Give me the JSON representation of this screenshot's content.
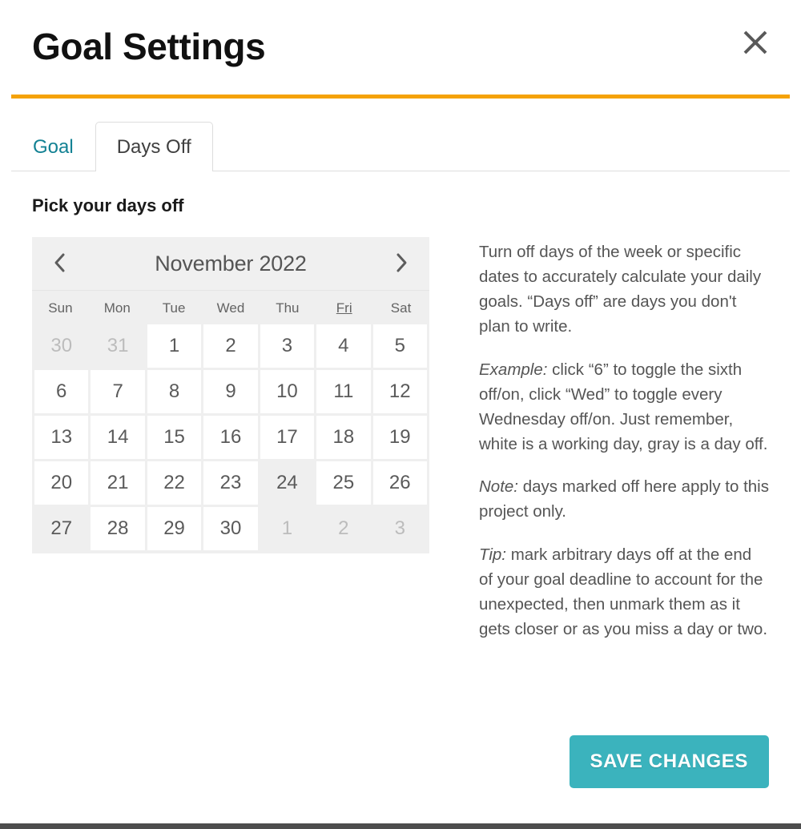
{
  "header": {
    "title": "Goal Settings",
    "close_icon": "close-icon",
    "rule_color": "#f5a207"
  },
  "tabs": [
    {
      "label": "Goal",
      "active": false
    },
    {
      "label": "Days Off",
      "active": true
    }
  ],
  "main": {
    "section_heading": "Pick your days off"
  },
  "calendar": {
    "prev_icon": "chevron-left-icon",
    "next_icon": "chevron-right-icon",
    "month_label": "November 2022",
    "weekdays": [
      {
        "label": "Sun",
        "underlined": false
      },
      {
        "label": "Mon",
        "underlined": false
      },
      {
        "label": "Tue",
        "underlined": false
      },
      {
        "label": "Wed",
        "underlined": false
      },
      {
        "label": "Thu",
        "underlined": false
      },
      {
        "label": "Fri",
        "underlined": true
      },
      {
        "label": "Sat",
        "underlined": false
      }
    ],
    "weeks": [
      [
        {
          "day": "30",
          "state": "outside"
        },
        {
          "day": "31",
          "state": "outside"
        },
        {
          "day": "1",
          "state": "work"
        },
        {
          "day": "2",
          "state": "work"
        },
        {
          "day": "3",
          "state": "work"
        },
        {
          "day": "4",
          "state": "work"
        },
        {
          "day": "5",
          "state": "work"
        }
      ],
      [
        {
          "day": "6",
          "state": "work"
        },
        {
          "day": "7",
          "state": "work"
        },
        {
          "day": "8",
          "state": "work"
        },
        {
          "day": "9",
          "state": "work"
        },
        {
          "day": "10",
          "state": "work"
        },
        {
          "day": "11",
          "state": "work"
        },
        {
          "day": "12",
          "state": "work"
        }
      ],
      [
        {
          "day": "13",
          "state": "work"
        },
        {
          "day": "14",
          "state": "work"
        },
        {
          "day": "15",
          "state": "work"
        },
        {
          "day": "16",
          "state": "work"
        },
        {
          "day": "17",
          "state": "work"
        },
        {
          "day": "18",
          "state": "work"
        },
        {
          "day": "19",
          "state": "work"
        }
      ],
      [
        {
          "day": "20",
          "state": "work"
        },
        {
          "day": "21",
          "state": "work"
        },
        {
          "day": "22",
          "state": "work"
        },
        {
          "day": "23",
          "state": "work"
        },
        {
          "day": "24",
          "state": "off"
        },
        {
          "day": "25",
          "state": "work"
        },
        {
          "day": "26",
          "state": "work"
        }
      ],
      [
        {
          "day": "27",
          "state": "off"
        },
        {
          "day": "28",
          "state": "work"
        },
        {
          "day": "29",
          "state": "work"
        },
        {
          "day": "30",
          "state": "work"
        },
        {
          "day": "1",
          "state": "outside"
        },
        {
          "day": "2",
          "state": "outside"
        },
        {
          "day": "3",
          "state": "outside"
        }
      ]
    ]
  },
  "help": {
    "paragraphs": [
      {
        "lead": "",
        "text": "Turn off days of the week or specific dates to accurately calculate your daily goals. “Days off” are days you don't plan to write."
      },
      {
        "lead": "Example:",
        "text": " click “6” to toggle the sixth off/on, click “Wed” to toggle every Wednesday off/on. Just remember, white is a working day, gray is a day off."
      },
      {
        "lead": "Note:",
        "text": " days marked off here apply to this project only."
      },
      {
        "lead": "Tip:",
        "text": " mark arbitrary days off at the end of your goal deadline to account for the unexpected, then unmark them as it gets closer or as you miss a day or two."
      }
    ]
  },
  "footer": {
    "save_label": "SAVE CHANGES",
    "save_color": "#3bb3bd"
  }
}
